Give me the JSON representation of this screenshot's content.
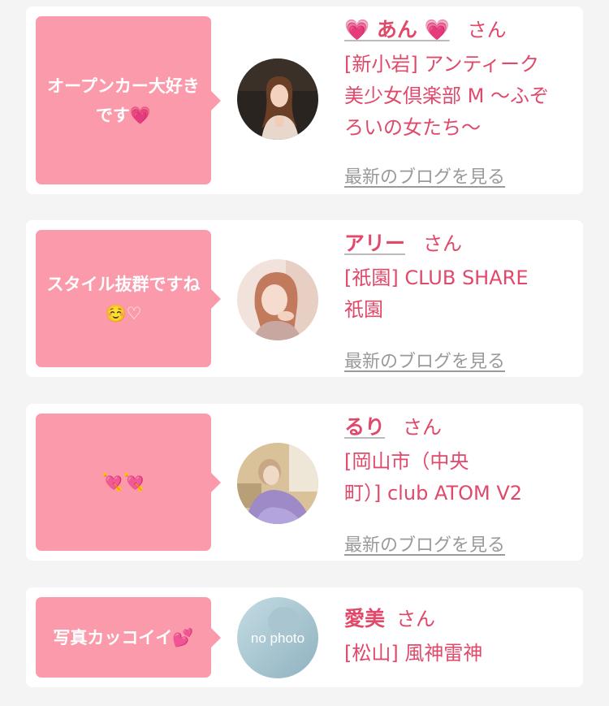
{
  "posts": [
    {
      "message": "オープンカー大好きです💗",
      "name": "💗 あん 💗",
      "honorific": "さん",
      "shop_lines": [
        "[新小岩] アンティーク",
        "美少女倶楽部 M 〜ふぞ",
        "ろいの女たち〜"
      ],
      "blog_link": "最新のブログを見る"
    },
    {
      "message": "スタイル抜群ですね☺️♡",
      "name": "アリー",
      "honorific": "さん",
      "shop_lines": [
        "[祇園] CLUB SHARE",
        "祇園"
      ],
      "blog_link": "最新のブログを見る"
    },
    {
      "message": "💘💘",
      "name": "るり",
      "honorific": "さん",
      "shop_lines": [
        "[岡山市（中央",
        "町）] club ATOM V2"
      ],
      "blog_link": "最新のブログを見る"
    },
    {
      "message": "写真カッコイイ💕",
      "name": "愛美",
      "honorific": "さん",
      "shop_lines": [
        "[松山] 風神雷神"
      ],
      "avatar_text": "no photo"
    }
  ],
  "colors": {
    "bubble": "#fb9aab",
    "accent": "#e0496a",
    "link_gray": "#9a9a9a",
    "background": "#f4f4f4"
  }
}
